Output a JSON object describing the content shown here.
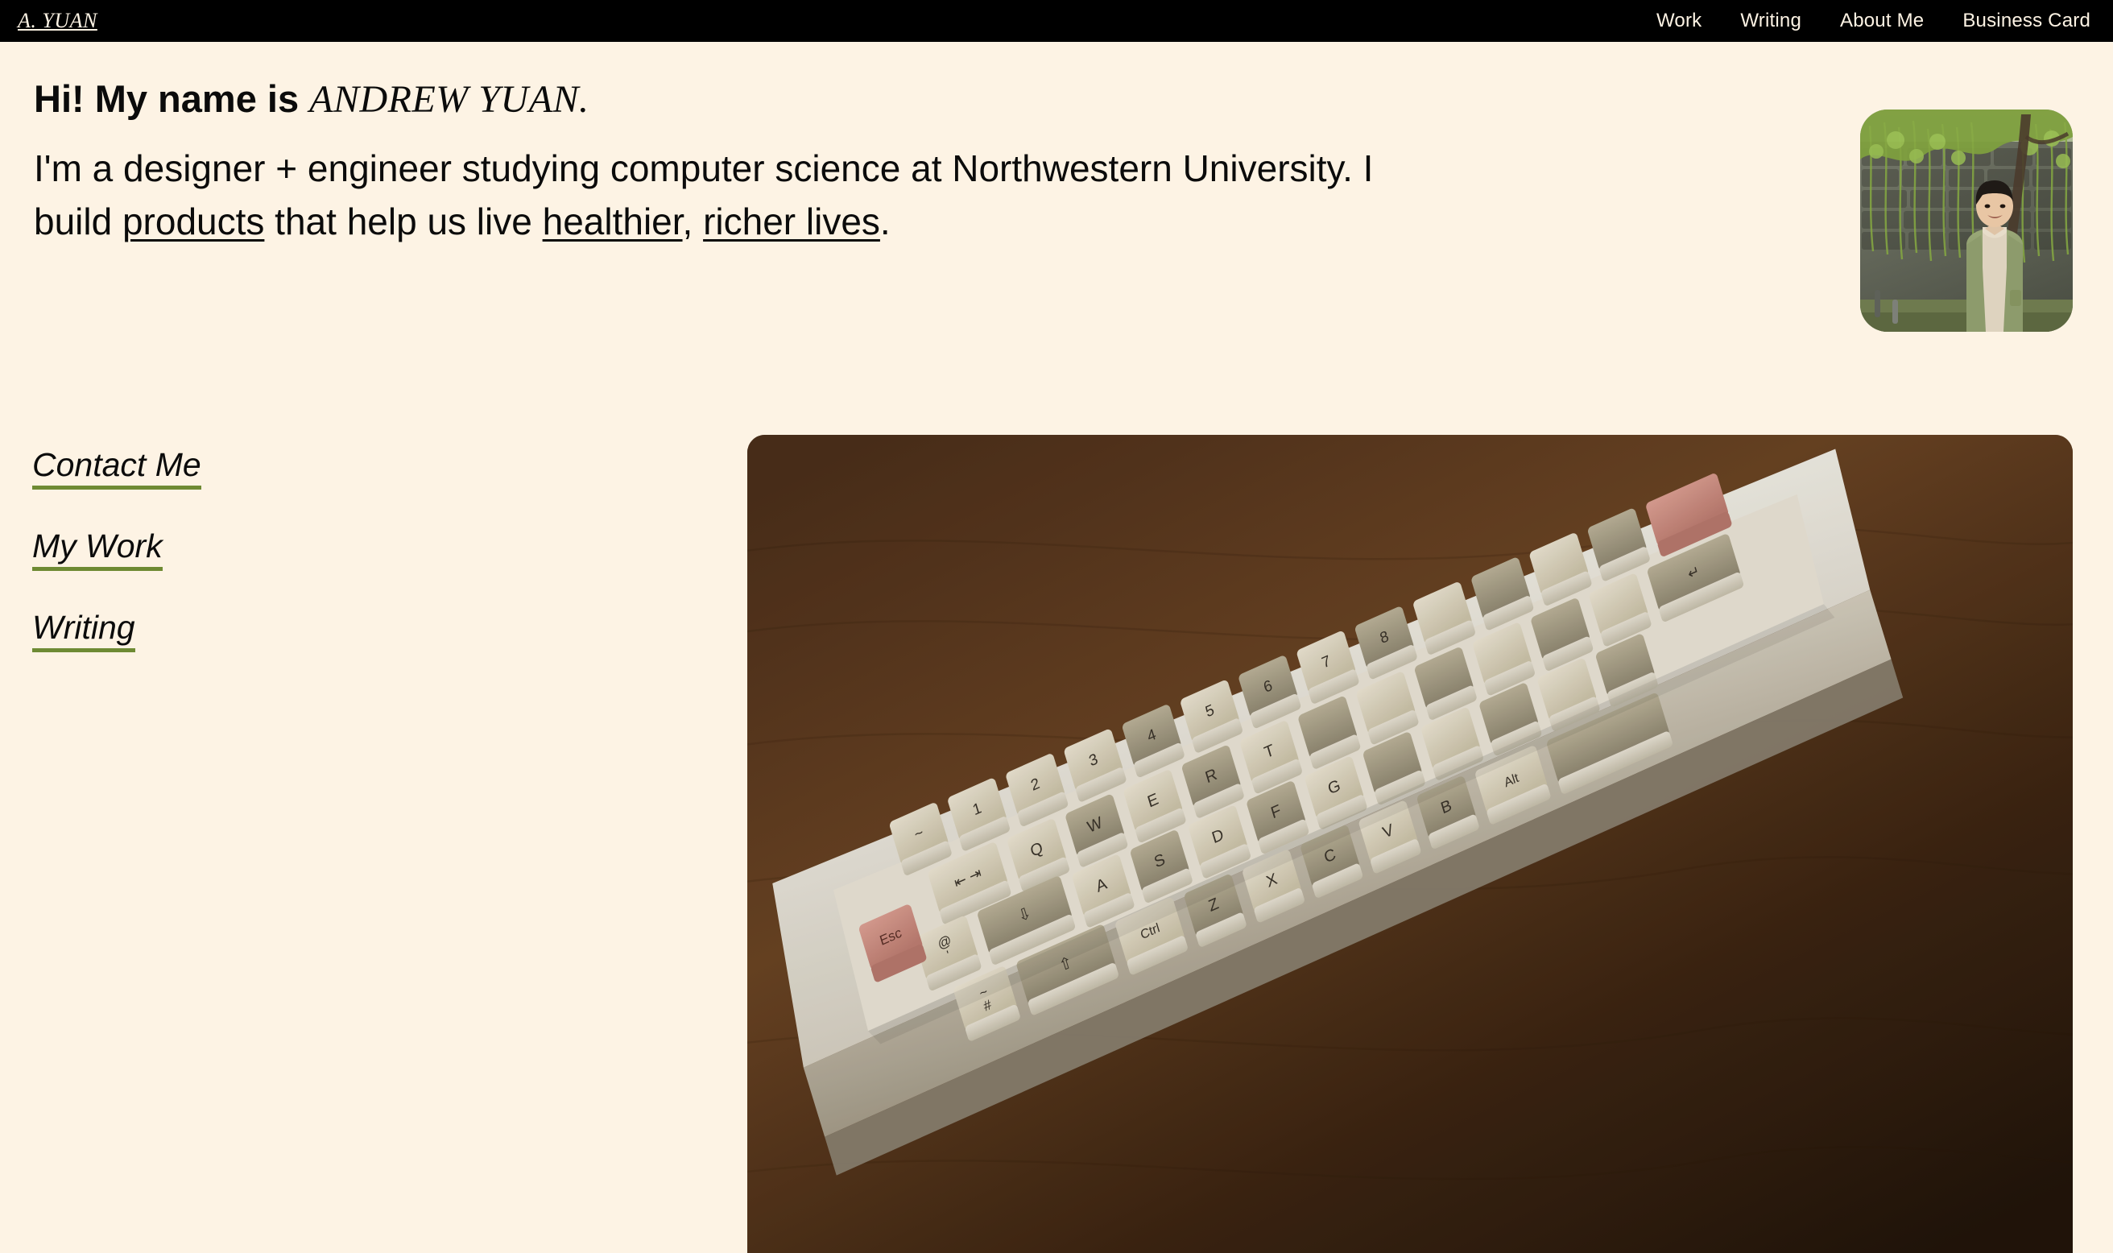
{
  "theme": {
    "background": "#FDF3E4",
    "topbar_background": "#000000",
    "topbar_text": "#FDF3E4",
    "text": "#0B0B0B",
    "link_underline_green": "#6E8A33"
  },
  "topbar": {
    "brand": "A. YUAN",
    "nav": [
      {
        "label": "Work"
      },
      {
        "label": "Writing"
      },
      {
        "label": "About Me"
      },
      {
        "label": "Business Card"
      }
    ]
  },
  "hero": {
    "greeting": "Hi! My name is ",
    "name": "ANDREW YUAN.",
    "body": {
      "part1": "I'm a designer + engineer studying computer science at Northwestern University. I build ",
      "link1": "products",
      "part2": " that help us live ",
      "link2": "healthier",
      "part3": ", ",
      "link3": "richer lives",
      "part4": "."
    }
  },
  "quicklinks": [
    {
      "label": "Contact Me"
    },
    {
      "label": "My Work"
    },
    {
      "label": "Writing"
    }
  ],
  "portrait": {
    "alt": "Andrew Yuan standing in front of a willow tree by a stone wall, wearing a green jacket"
  },
  "photo": {
    "alt": "Close-up of a beige mechanical keyboard with a salmon Esc keycap on a dark wood desk",
    "keycaps": [
      "Esc",
      "@",
      "~",
      "#",
      "Q",
      "A",
      "Z",
      "S",
      "X",
      "W",
      "E",
      "D",
      "C",
      "R",
      "T",
      "F",
      "G",
      "V",
      "B",
      "Ctrl",
      "Alt",
      "1",
      "2",
      "3",
      "4",
      "5",
      "6",
      "7",
      "8"
    ]
  }
}
